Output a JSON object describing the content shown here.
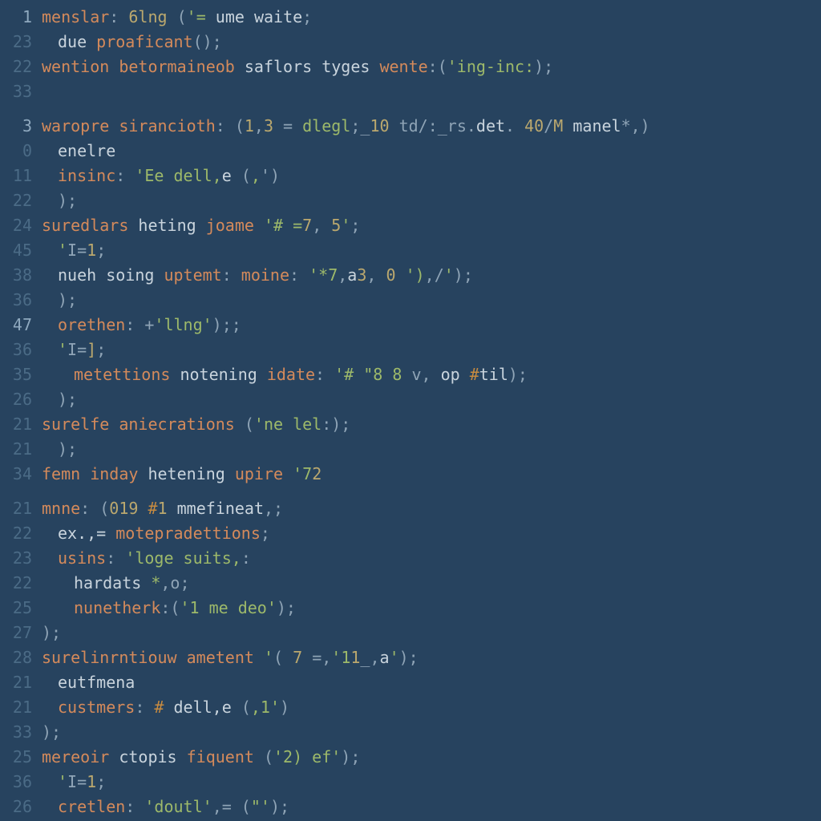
{
  "lines": [
    {
      "num": "1",
      "hl": true,
      "indent": 0,
      "tokens": [
        {
          "c": "t-key",
          "t": "menslar"
        },
        {
          "c": "t-pun",
          "t": ": "
        },
        {
          "c": "t-num",
          "t": "6lng"
        },
        {
          "c": "t-pun",
          "t": " ("
        },
        {
          "c": "t-str",
          "t": "'= "
        },
        {
          "c": "t-id",
          "t": "ume waite"
        },
        {
          "c": "t-pun",
          "t": ";"
        }
      ]
    },
    {
      "num": "23",
      "indent": 1,
      "tokens": [
        {
          "c": "t-id",
          "t": "due "
        },
        {
          "c": "t-key",
          "t": "proaficant"
        },
        {
          "c": "t-pun",
          "t": "();"
        }
      ]
    },
    {
      "num": "22",
      "indent": 0,
      "tokens": [
        {
          "c": "t-key",
          "t": "wention "
        },
        {
          "c": "t-key",
          "t": "betormaineob "
        },
        {
          "c": "t-id",
          "t": "saflors tyges "
        },
        {
          "c": "t-key",
          "t": "wente"
        },
        {
          "c": "t-pun",
          "t": ":("
        },
        {
          "c": "t-str",
          "t": "'ing-inc:"
        },
        {
          "c": "t-pun",
          "t": ");"
        }
      ]
    },
    {
      "num": "33",
      "indent": 0,
      "tokens": [
        {
          "c": "t-pun",
          "t": ""
        }
      ]
    },
    {
      "num": "3",
      "hl": true,
      "indent": 0,
      "spacer": true,
      "tokens": [
        {
          "c": "t-key",
          "t": "waropre "
        },
        {
          "c": "t-key",
          "t": "sirancioth"
        },
        {
          "c": "t-pun",
          "t": ": ("
        },
        {
          "c": "t-num",
          "t": "1"
        },
        {
          "c": "t-pun",
          "t": ","
        },
        {
          "c": "t-num",
          "t": "3"
        },
        {
          "c": "t-pun",
          "t": " = "
        },
        {
          "c": "t-str",
          "t": "dlegl"
        },
        {
          "c": "t-pun",
          "t": ";_"
        },
        {
          "c": "t-num",
          "t": "10"
        },
        {
          "c": "t-pun",
          "t": " td/:_rs."
        },
        {
          "c": "t-id",
          "t": "det"
        },
        {
          "c": "t-pun",
          "t": ". "
        },
        {
          "c": "t-num",
          "t": "40"
        },
        {
          "c": "t-pun",
          "t": "/"
        },
        {
          "c": "t-num",
          "t": "M"
        },
        {
          "c": "t-id",
          "t": " manel"
        },
        {
          "c": "t-pun",
          "t": "*,)"
        }
      ]
    },
    {
      "num": "0",
      "indent": 1,
      "tokens": [
        {
          "c": "t-id",
          "t": "enelre"
        }
      ]
    },
    {
      "num": "11",
      "indent": 1,
      "tokens": [
        {
          "c": "t-key",
          "t": "insinc"
        },
        {
          "c": "t-pun",
          "t": ": "
        },
        {
          "c": "t-str",
          "t": "'Ee dell,"
        },
        {
          "c": "t-id",
          "t": "e "
        },
        {
          "c": "t-pun",
          "t": "("
        },
        {
          "c": "t-str",
          "t": ","
        },
        {
          "c": "t-pun",
          "t": "')"
        }
      ]
    },
    {
      "num": "22",
      "indent": 1,
      "tokens": [
        {
          "c": "t-pun",
          "t": ");"
        }
      ]
    },
    {
      "num": "24",
      "indent": 0,
      "tokens": [
        {
          "c": "t-key",
          "t": "suredlars "
        },
        {
          "c": "t-id",
          "t": "heting "
        },
        {
          "c": "t-key",
          "t": "joame "
        },
        {
          "c": "t-str",
          "t": "'# ="
        },
        {
          "c": "t-num",
          "t": "7"
        },
        {
          "c": "t-pun",
          "t": ", "
        },
        {
          "c": "t-num",
          "t": "5"
        },
        {
          "c": "t-str",
          "t": "'"
        },
        {
          "c": "t-pun",
          "t": ";"
        }
      ]
    },
    {
      "num": "45",
      "indent": 1,
      "tokens": [
        {
          "c": "t-str",
          "t": "'"
        },
        {
          "c": "t-pun",
          "t": "I="
        },
        {
          "c": "t-num",
          "t": "1"
        },
        {
          "c": "t-pun",
          "t": ";"
        }
      ]
    },
    {
      "num": "38",
      "indent": 1,
      "tokens": [
        {
          "c": "t-id",
          "t": "nueh soing "
        },
        {
          "c": "t-key",
          "t": "uptemt"
        },
        {
          "c": "t-pun",
          "t": ": "
        },
        {
          "c": "t-key",
          "t": "moine"
        },
        {
          "c": "t-pun",
          "t": ": "
        },
        {
          "c": "t-str",
          "t": "'*7"
        },
        {
          "c": "t-pun",
          "t": ","
        },
        {
          "c": "t-id",
          "t": "a"
        },
        {
          "c": "t-num",
          "t": "3"
        },
        {
          "c": "t-pun",
          "t": ", "
        },
        {
          "c": "t-num",
          "t": "0 "
        },
        {
          "c": "t-str",
          "t": "')"
        },
        {
          "c": "t-pun",
          "t": ",/"
        },
        {
          "c": "t-str",
          "t": "'"
        },
        {
          "c": "t-pun",
          "t": ");"
        }
      ]
    },
    {
      "num": "36",
      "indent": 1,
      "tokens": [
        {
          "c": "t-pun",
          "t": ");"
        }
      ]
    },
    {
      "num": "47",
      "hl": true,
      "indent": 1,
      "tokens": [
        {
          "c": "t-key",
          "t": "orethen"
        },
        {
          "c": "t-pun",
          "t": ": +"
        },
        {
          "c": "t-str",
          "t": "'llng'"
        },
        {
          "c": "t-pun",
          "t": ");;"
        }
      ]
    },
    {
      "num": "36",
      "indent": 1,
      "tokens": [
        {
          "c": "t-str",
          "t": "'"
        },
        {
          "c": "t-pun",
          "t": "I="
        },
        {
          "c": "t-num",
          "t": "]"
        },
        {
          "c": "t-pun",
          "t": ";"
        }
      ]
    },
    {
      "num": "35",
      "indent": 2,
      "tokens": [
        {
          "c": "t-key",
          "t": "metettions "
        },
        {
          "c": "t-id",
          "t": "notening "
        },
        {
          "c": "t-key",
          "t": "idate"
        },
        {
          "c": "t-pun",
          "t": ": "
        },
        {
          "c": "t-str",
          "t": "'# \"8 8 "
        },
        {
          "c": "t-pun",
          "t": "v, "
        },
        {
          "c": "t-id",
          "t": "op "
        },
        {
          "c": "t-op",
          "t": "#"
        },
        {
          "c": "t-id",
          "t": "til"
        },
        {
          "c": "t-pun",
          "t": ");"
        }
      ]
    },
    {
      "num": "26",
      "indent": 1,
      "tokens": [
        {
          "c": "t-pun",
          "t": ");"
        }
      ]
    },
    {
      "num": "21",
      "indent": 0,
      "tokens": [
        {
          "c": "t-key",
          "t": "surelfe "
        },
        {
          "c": "t-key",
          "t": "aniecrations "
        },
        {
          "c": "t-pun",
          "t": "("
        },
        {
          "c": "t-str",
          "t": "'ne lel"
        },
        {
          "c": "t-pun",
          "t": ":);"
        }
      ]
    },
    {
      "num": "21",
      "indent": 1,
      "tokens": [
        {
          "c": "t-pun",
          "t": ");"
        }
      ]
    },
    {
      "num": "34",
      "indent": 0,
      "tokens": [
        {
          "c": "t-key",
          "t": "femn "
        },
        {
          "c": "t-key",
          "t": "inday "
        },
        {
          "c": "t-id",
          "t": "hetening "
        },
        {
          "c": "t-key",
          "t": "upire "
        },
        {
          "c": "t-str",
          "t": "'7"
        },
        {
          "c": "t-num",
          "t": "2"
        }
      ]
    },
    {
      "num": "",
      "indent": 0,
      "spacer": true,
      "tokens": [
        {
          "c": "t-pun",
          "t": ""
        }
      ]
    },
    {
      "num": "21",
      "indent": 0,
      "tokens": [
        {
          "c": "t-key",
          "t": "mnne"
        },
        {
          "c": "t-pun",
          "t": ": ("
        },
        {
          "c": "t-num",
          "t": "019 "
        },
        {
          "c": "t-op",
          "t": "#"
        },
        {
          "c": "t-num",
          "t": "1 "
        },
        {
          "c": "t-id",
          "t": "mmefineat"
        },
        {
          "c": "t-pun",
          "t": ",;"
        }
      ]
    },
    {
      "num": "22",
      "indent": 1,
      "tokens": [
        {
          "c": "t-id",
          "t": "ex.,= "
        },
        {
          "c": "t-key",
          "t": "motepradettions"
        },
        {
          "c": "t-pun",
          "t": ";"
        }
      ]
    },
    {
      "num": "23",
      "indent": 1,
      "tokens": [
        {
          "c": "t-key",
          "t": "usins"
        },
        {
          "c": "t-pun",
          "t": ": "
        },
        {
          "c": "t-str",
          "t": "'loge suits,"
        },
        {
          "c": "t-pun",
          "t": ":"
        }
      ]
    },
    {
      "num": "22",
      "indent": 2,
      "tokens": [
        {
          "c": "t-id",
          "t": "hardats "
        },
        {
          "c": "t-str",
          "t": "*"
        },
        {
          "c": "t-pun",
          "t": ",o;"
        }
      ]
    },
    {
      "num": "25",
      "indent": 2,
      "tokens": [
        {
          "c": "t-key",
          "t": "nunetherk"
        },
        {
          "c": "t-pun",
          "t": ":("
        },
        {
          "c": "t-str",
          "t": "'1 me deo'"
        },
        {
          "c": "t-pun",
          "t": ");"
        }
      ]
    },
    {
      "num": "27",
      "indent": 0,
      "tokens": [
        {
          "c": "t-pun",
          "t": ");"
        }
      ]
    },
    {
      "num": "28",
      "indent": 0,
      "tokens": [
        {
          "c": "t-key",
          "t": "surelinrntiouw "
        },
        {
          "c": "t-key",
          "t": "ametent "
        },
        {
          "c": "t-str",
          "t": "'"
        },
        {
          "c": "t-pun",
          "t": "( "
        },
        {
          "c": "t-num",
          "t": "7 "
        },
        {
          "c": "t-pun",
          "t": "=,"
        },
        {
          "c": "t-str",
          "t": "'1"
        },
        {
          "c": "t-num",
          "t": "1"
        },
        {
          "c": "t-pun",
          "t": "_,"
        },
        {
          "c": "t-id",
          "t": "a"
        },
        {
          "c": "t-str",
          "t": "'"
        },
        {
          "c": "t-pun",
          "t": ");"
        }
      ]
    },
    {
      "num": "21",
      "indent": 1,
      "tokens": [
        {
          "c": "t-id",
          "t": "eutfmena"
        }
      ]
    },
    {
      "num": "21",
      "indent": 1,
      "tokens": [
        {
          "c": "t-key",
          "t": "custmers"
        },
        {
          "c": "t-pun",
          "t": ": "
        },
        {
          "c": "t-op",
          "t": "# "
        },
        {
          "c": "t-id",
          "t": "dell,"
        },
        {
          "c": "t-id",
          "t": "e "
        },
        {
          "c": "t-pun",
          "t": "("
        },
        {
          "c": "t-str",
          "t": ",1'"
        },
        {
          "c": "t-pun",
          "t": ")"
        }
      ]
    },
    {
      "num": "33",
      "indent": 0,
      "tokens": [
        {
          "c": "t-pun",
          "t": ");"
        }
      ]
    },
    {
      "num": "25",
      "indent": 0,
      "tokens": [
        {
          "c": "t-key",
          "t": "mereoir "
        },
        {
          "c": "t-id",
          "t": "ctopis "
        },
        {
          "c": "t-key",
          "t": "fiquent "
        },
        {
          "c": "t-pun",
          "t": "("
        },
        {
          "c": "t-str",
          "t": "'2) ef'"
        },
        {
          "c": "t-pun",
          "t": ");"
        }
      ]
    },
    {
      "num": "36",
      "indent": 1,
      "tokens": [
        {
          "c": "t-str",
          "t": "'"
        },
        {
          "c": "t-pun",
          "t": "I="
        },
        {
          "c": "t-num",
          "t": "1"
        },
        {
          "c": "t-pun",
          "t": ";"
        }
      ]
    },
    {
      "num": "26",
      "indent": 1,
      "tokens": [
        {
          "c": "t-key",
          "t": "cretlen"
        },
        {
          "c": "t-pun",
          "t": ": "
        },
        {
          "c": "t-str",
          "t": "'doutl'"
        },
        {
          "c": "t-pun",
          "t": ",= ("
        },
        {
          "c": "t-str",
          "t": "\"'"
        },
        {
          "c": "t-pun",
          "t": ");"
        }
      ]
    }
  ]
}
